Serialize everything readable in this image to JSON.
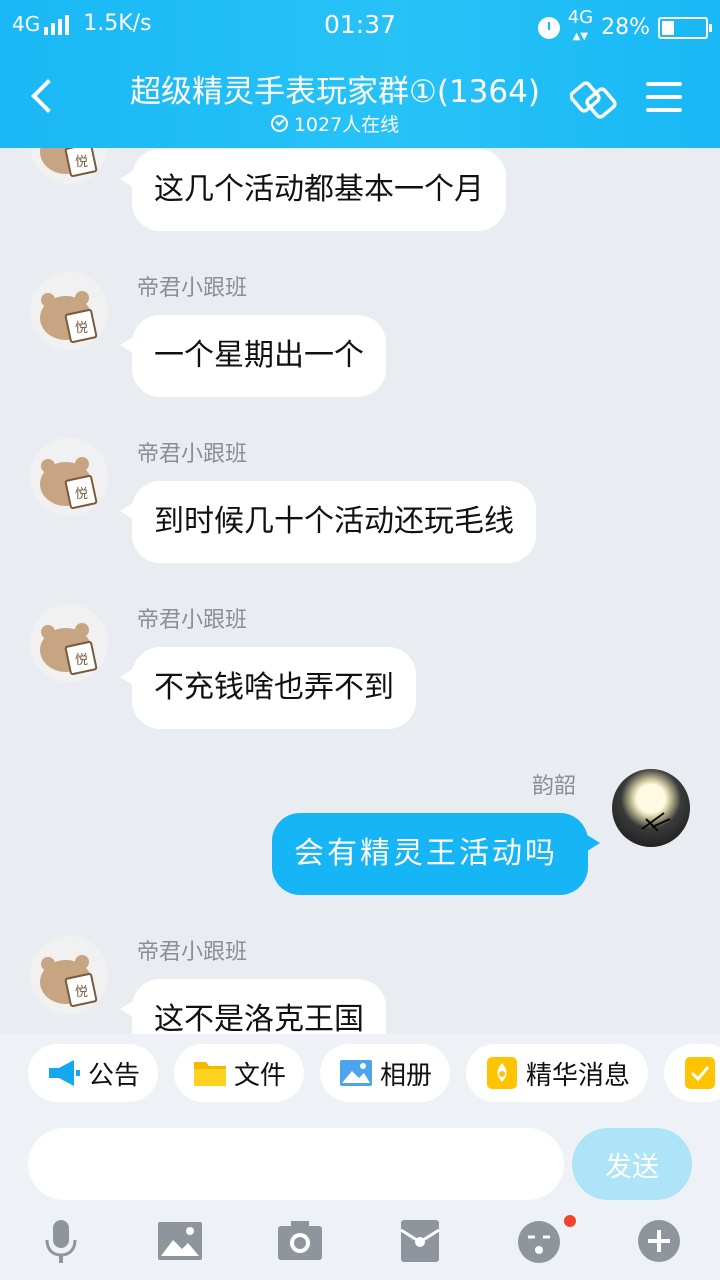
{
  "status_bar": {
    "network": "4G",
    "speed": "1.5K/s",
    "time": "01:37",
    "net_type": "4G",
    "battery": "28%",
    "battery_level": 0.28
  },
  "header": {
    "title": "超级精灵手表玩家群①(1364)",
    "online": "1027人在线"
  },
  "messages": [
    {
      "sender": "",
      "text": "这几个活动都基本一个月",
      "direction": "in"
    },
    {
      "sender": "帝君小跟班",
      "text": "一个星期出一个",
      "direction": "in"
    },
    {
      "sender": "帝君小跟班",
      "text": "到时候几十个活动还玩毛线",
      "direction": "in"
    },
    {
      "sender": "帝君小跟班",
      "text": "不充钱啥也弄不到",
      "direction": "in"
    },
    {
      "sender": "韵韶",
      "text": "会有精灵王活动吗",
      "direction": "out"
    },
    {
      "sender": "帝君小跟班",
      "text": "这不是洛克王国",
      "direction": "in"
    }
  ],
  "shortcuts": [
    {
      "label": "公告",
      "icon": "megaphone-icon"
    },
    {
      "label": "文件",
      "icon": "folder-icon"
    },
    {
      "label": "相册",
      "icon": "album-icon"
    },
    {
      "label": "精华消息",
      "icon": "essence-icon"
    }
  ],
  "input": {
    "value": "",
    "placeholder": ""
  },
  "send_label": "发送",
  "colors": {
    "accent": "#16b5f5",
    "header": "#22bdf6",
    "send_disabled": "#aee4f8",
    "badge": "#f0452d"
  }
}
